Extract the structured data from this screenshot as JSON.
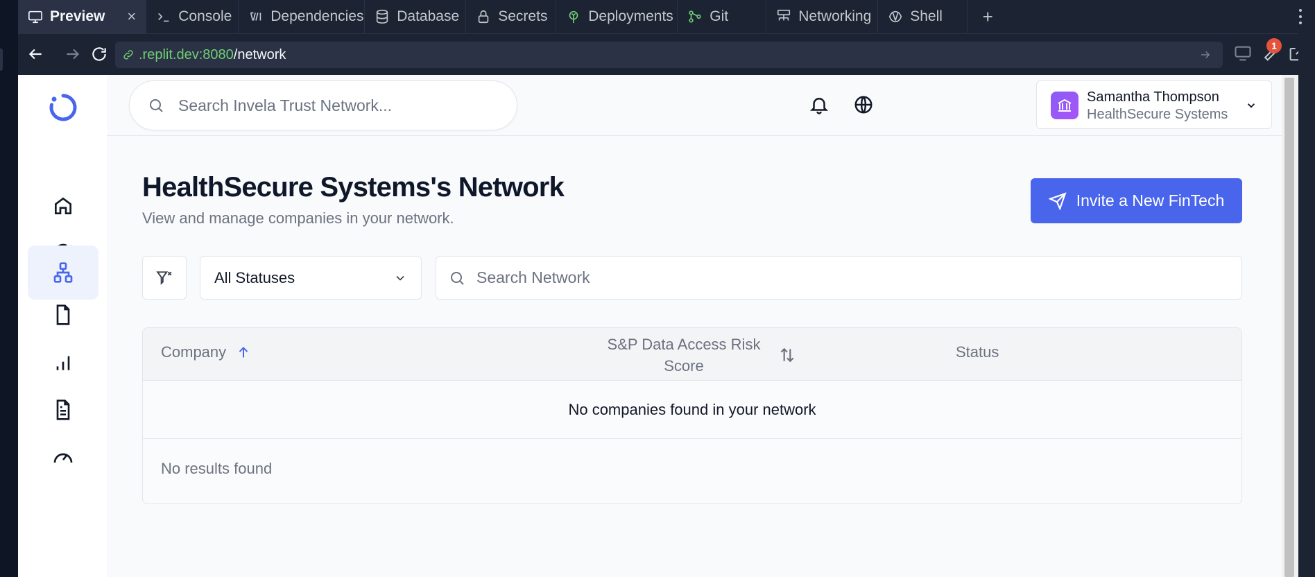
{
  "ide": {
    "tabs": [
      {
        "label": "Preview",
        "icon": "monitor-icon",
        "active": true
      },
      {
        "label": "Console",
        "icon": "terminal-icon"
      },
      {
        "label": "Dependencies",
        "icon": "dependencies-icon"
      },
      {
        "label": "Database",
        "icon": "database-icon"
      },
      {
        "label": "Secrets",
        "icon": "lock-icon"
      },
      {
        "label": "Deployments",
        "icon": "deployments-icon"
      },
      {
        "label": "Git",
        "icon": "git-icon"
      },
      {
        "label": "Networking",
        "icon": "networking-icon"
      },
      {
        "label": "Shell",
        "icon": "shell-icon"
      }
    ],
    "close_glyph": "×",
    "add_glyph": "+",
    "url": {
      "host": ".replit.dev:8080",
      "path": "/network"
    },
    "notification_count": "1",
    "colors": {
      "url_host": "#6fcf73",
      "badge": "#e5533d"
    }
  },
  "app": {
    "header": {
      "search_placeholder": "Search Invela Trust Network...",
      "user_name": "Samantha Thompson",
      "user_org": "HealthSecure Systems"
    },
    "sidebar": {
      "items": [
        "home-icon",
        "check-circle-icon",
        "network-icon",
        "file-icon",
        "bar-chart-icon",
        "document-icon",
        "gauge-icon"
      ],
      "active": "network-icon"
    },
    "page": {
      "title": "HealthSecure Systems's Network",
      "subtitle": "View and manage companies in your network.",
      "invite_label": "Invite a New FinTech"
    },
    "filters": {
      "status_value": "All Statuses",
      "search_placeholder": "Search Network"
    },
    "table": {
      "columns": {
        "company": "Company",
        "risk": "S&P Data Access Risk Score",
        "status": "Status"
      },
      "empty_message": "No companies found in your network",
      "no_results": "No results found"
    },
    "colors": {
      "primary": "#4965ec",
      "avatar": "#9b5cf6"
    }
  }
}
